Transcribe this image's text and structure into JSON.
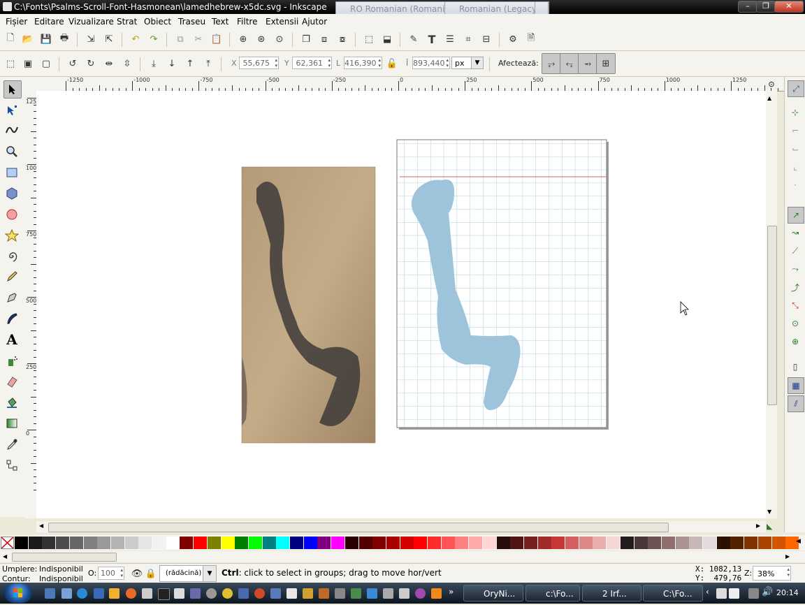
{
  "window": {
    "title": "C:\\Fonts\\Psalms-Scroll-Font-Hasmonean\\lamedhebrew-x5dc.svg - Inkscape"
  },
  "langbar": {
    "primary": "RO Romanian (Romania)",
    "secondary": "Romanian (Legacy)"
  },
  "menu": [
    "Fișier",
    "Editare",
    "Vizualizare",
    "Strat",
    "Obiect",
    "Traseu",
    "Text",
    "Filtre",
    "Extensii",
    "Ajutor"
  ],
  "controls": {
    "x_label": "X",
    "x_value": "55,675",
    "y_label": "Y",
    "y_value": "62,361",
    "w_label": "L",
    "w_value": "416,390",
    "h_label": "Î",
    "h_value": "893,440",
    "unit": "px",
    "affect_label": "Afectează:"
  },
  "ruler": {
    "h_labels": [
      "-1250",
      "-1000",
      "-750",
      "-500",
      "-250",
      "0",
      "250",
      "500",
      "750",
      "1000",
      "1250"
    ],
    "v_labels": [
      "1250",
      "1000",
      "750",
      "500",
      "250",
      "0"
    ]
  },
  "palette": {
    "colors": [
      "#000000",
      "#1a1a1a",
      "#333333",
      "#4d4d4d",
      "#666666",
      "#808080",
      "#999999",
      "#b3b3b3",
      "#cccccc",
      "#e6e6e6",
      "#f2f2f2",
      "#ffffff",
      "#800000",
      "#ff0000",
      "#808000",
      "#ffff00",
      "#008000",
      "#00ff00",
      "#008080",
      "#00ffff",
      "#000080",
      "#0000ff",
      "#800080",
      "#ff00ff",
      "#2b0000",
      "#550000",
      "#800000",
      "#aa0000",
      "#d40000",
      "#ff0000",
      "#ff2a2a",
      "#ff5555",
      "#ff8080",
      "#ffaaaa",
      "#ffd5d5",
      "#280b0b",
      "#501616",
      "#782121",
      "#a02c2c",
      "#c83737",
      "#d35f5f",
      "#de8787",
      "#e9afaf",
      "#f4d7d7",
      "#241c1c",
      "#483737",
      "#6c5353",
      "#916f6f",
      "#ac9393",
      "#c8b7b7",
      "#e3dbdb",
      "#2b1100",
      "#552200",
      "#803300",
      "#aa4400",
      "#d45500",
      "#ff6600"
    ]
  },
  "status": {
    "fill_label": "Umplere:",
    "fill_value": "Indisponibil",
    "stroke_label": "Contur:",
    "stroke_value": "Indisponibil",
    "opacity_label": "O:",
    "opacity_value": "100",
    "layer": "(rădăcină)",
    "message_key": "Ctrl",
    "message": ": click to select in groups; drag to move hor/vert",
    "cursor_x": "X: 1082,13",
    "cursor_y": "Y:  479,76",
    "zoom_label": "Z:",
    "zoom_value": "38%"
  },
  "taskbar": {
    "tasks": [
      "OryNi...",
      "c:\\Fo...",
      "2 Irf...",
      "C:\\Fo..."
    ],
    "clock": "20:14"
  }
}
